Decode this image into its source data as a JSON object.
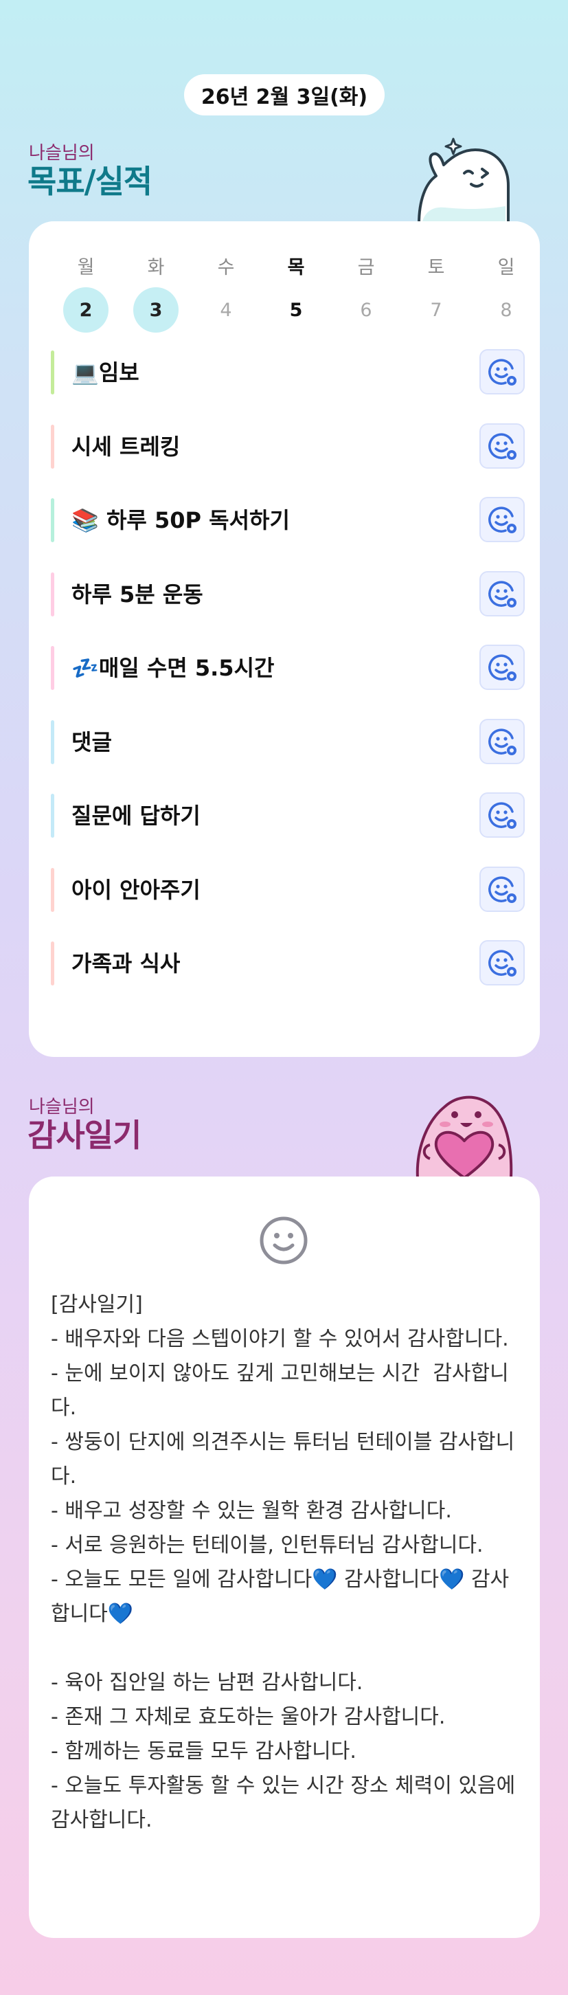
{
  "date": "26년 2월 3일(화)",
  "goal_section": {
    "owner": "나슬님의",
    "title": "목표/실적"
  },
  "week": [
    {
      "label": "월",
      "num": "2",
      "state": "done"
    },
    {
      "label": "화",
      "num": "3",
      "state": "done"
    },
    {
      "label": "수",
      "num": "4",
      "state": "future"
    },
    {
      "label": "목",
      "num": "5",
      "state": "today"
    },
    {
      "label": "금",
      "num": "6",
      "state": "future"
    },
    {
      "label": "토",
      "num": "7",
      "state": "future"
    },
    {
      "label": "일",
      "num": "8",
      "state": "future"
    }
  ],
  "goals": [
    {
      "text": "💻임보",
      "bar": "#c4ec9a"
    },
    {
      "text": "시세 트레킹",
      "bar": "#ffd3cf"
    },
    {
      "text": "📚 하루 50P 독서하기",
      "bar": "#b6f0dc"
    },
    {
      "text": "하루 5분 운동",
      "bar": "#ffcde4"
    },
    {
      "text": "💤매일 수면 5.5시간",
      "bar": "#ffcde4"
    },
    {
      "text": "댓글",
      "bar": "#c4eaf8"
    },
    {
      "text": "질문에 답하기",
      "bar": "#c4eaf8"
    },
    {
      "text": "아이 안아주기",
      "bar": "#ffd3cf"
    },
    {
      "text": "가족과 식사",
      "bar": "#ffd3cf"
    }
  ],
  "gratitude_section": {
    "owner": "나슬님의",
    "title": "감사일기"
  },
  "gratitude_text": "[감사일기]\n- 배우자와 다음 스텝이야기 할 수 있어서 감사합니다.\n- 눈에 보이지 않아도 깊게 고민해보는 시간  감사합니다.\n- 쌍둥이 단지에 의견주시는 튜터님 턴테이블 감사합니다.\n- 배우고 성장할 수 있는 월학 환경 감사합니다.\n- 서로 응원하는 턴테이블, 인턴튜터님 감사합니다.\n- 오늘도 모든 일에 감사합니다💙 감사합니다💙 감사합니다💙\n\n- 육아 집안일 하는 남편 감사합니다.\n- 존재 그 자체로 효도하는 울아가 감사합니다.\n- 함께하는 동료들 모두 감사합니다.\n- 오늘도 투자활동 할 수 있는 시간 장소 체력이 있음에 감사합니다.",
  "colors": {
    "accent_teal": "#0f7a8a",
    "accent_plum": "#8c2a6d",
    "done_day": "#c6eff4",
    "button_icon": "#3b6fe0"
  },
  "icons": {
    "goal_button": "smile-check-icon",
    "gratitude_mood": "smile-icon"
  }
}
